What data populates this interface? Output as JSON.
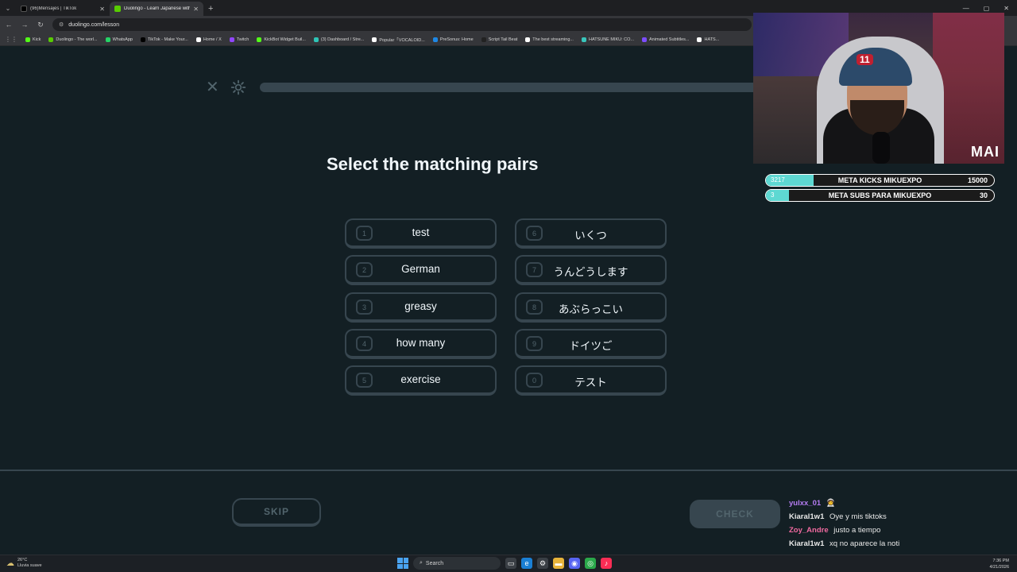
{
  "browser": {
    "tabs": [
      {
        "title": "(96)Mensajes | TikTok",
        "active": false,
        "favicon_color": "#000000"
      },
      {
        "title": "Duolingo - Learn Japanese with...",
        "active": true,
        "favicon_color": "#58cc02"
      }
    ],
    "new_tab": "+",
    "url": "duolingo.com/lesson",
    "bookmarks": [
      {
        "label": "Kick",
        "color": "#53fc18"
      },
      {
        "label": "Duolingo - The worl...",
        "color": "#58cc02"
      },
      {
        "label": "WhatsApp",
        "color": "#25d366"
      },
      {
        "label": "TikTok - Make Your...",
        "color": "#000000"
      },
      {
        "label": "Home / X",
        "color": "#ffffff"
      },
      {
        "label": "Twitch",
        "color": "#9146ff"
      },
      {
        "label": "KickBot Widget Buil...",
        "color": "#53fc18"
      },
      {
        "label": "(3) Dashboard / Stre...",
        "color": "#2ec4b6"
      },
      {
        "label": "Popular「VOCALOID...",
        "color": "#ffffff"
      },
      {
        "label": "PreSonus: Home",
        "color": "#1e88e5"
      },
      {
        "label": "Script Tail Beat",
        "color": "#222222"
      },
      {
        "label": "The best streaming...",
        "color": "#ffffff"
      },
      {
        "label": "HATSUNE MIKU: CO...",
        "color": "#39c5bb"
      },
      {
        "label": "Animated Subtitles...",
        "color": "#7c4dff"
      },
      {
        "label": "HATS...",
        "color": "#ffffff"
      }
    ]
  },
  "lesson": {
    "heading": "Select the matching pairs",
    "left_tiles": [
      {
        "num": "1",
        "text": "test"
      },
      {
        "num": "2",
        "text": "German"
      },
      {
        "num": "3",
        "text": "greasy"
      },
      {
        "num": "4",
        "text": "how many"
      },
      {
        "num": "5",
        "text": "exercise"
      }
    ],
    "right_tiles": [
      {
        "num": "6",
        "text": "いくつ"
      },
      {
        "num": "7",
        "text": "うんどうします"
      },
      {
        "num": "8",
        "text": "あぶらっこい"
      },
      {
        "num": "9",
        "text": "ドイツご"
      },
      {
        "num": "0",
        "text": "テスト"
      }
    ],
    "skip_label": "SKIP",
    "check_label": "CHECK",
    "progress": 0.0
  },
  "overlay": {
    "cap_number": "11",
    "brand": "MAI",
    "goals": [
      {
        "current": "3217",
        "title": "META KICKS MIKUEXPO",
        "target": "15000",
        "progress": 0.21
      },
      {
        "current": "3",
        "title": "META SUBS PARA MIKUEXPO",
        "target": "30",
        "progress": 0.1
      }
    ],
    "chat": [
      {
        "user": "yulxx_01",
        "user_color": "#b57cf2",
        "message": "🧑‍🚀"
      },
      {
        "user": "Kiaral1w1",
        "user_color": "#ffffff",
        "message": "Oye y mis tiktoks"
      },
      {
        "user": "Zoy_Andre",
        "user_color": "#f06aa0",
        "message": "justo a tiempo"
      },
      {
        "user": "Kiaral1w1",
        "user_color": "#ffffff",
        "message": "xq no aparece la noti"
      }
    ]
  },
  "taskbar": {
    "weather_temp": "26°C",
    "weather_desc": "Lluvia suave",
    "search_placeholder": "Search",
    "time": "7:36 PM",
    "date": "4/21/2026"
  },
  "colors": {
    "background": "#131f24",
    "border": "#37464f",
    "muted_text": "#52656d",
    "goal_fill": "#5ed8d2"
  }
}
